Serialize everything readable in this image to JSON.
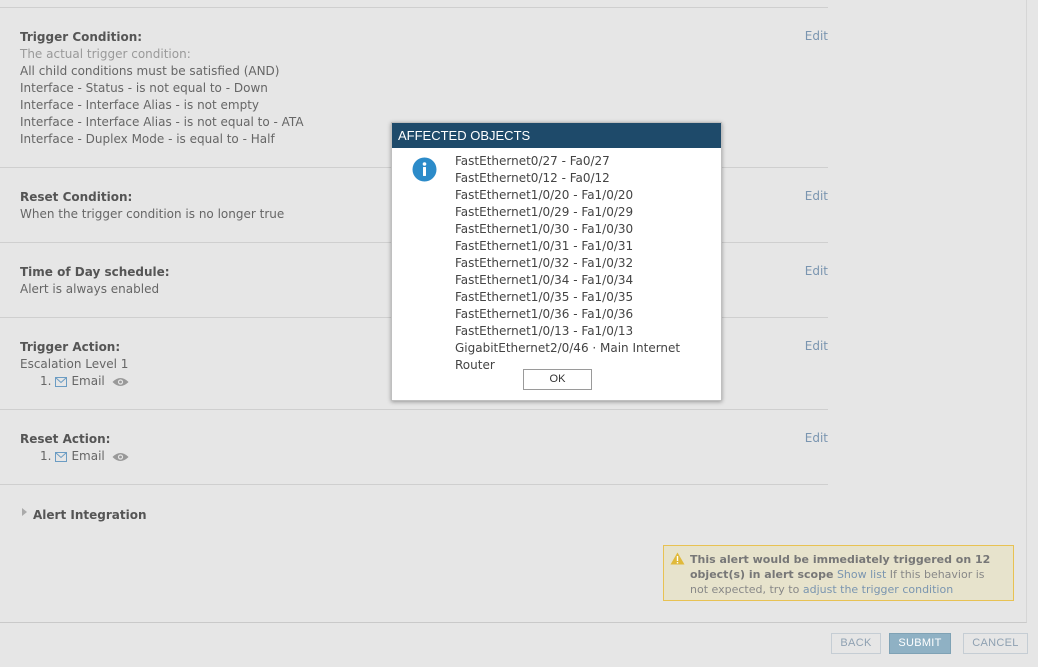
{
  "trigger_condition": {
    "title": "Trigger Condition:",
    "subtitle": "The actual trigger condition:",
    "lines": [
      "All child conditions must be satisfied (AND)",
      "Interface - Status - is not equal to - Down",
      "Interface - Interface Alias - is not empty",
      "Interface - Interface Alias - is not equal to - ATA",
      "Interface - Duplex Mode - is equal to - Half"
    ],
    "edit": "Edit"
  },
  "reset_condition": {
    "title": "Reset Condition:",
    "text": "When the trigger condition is no longer true",
    "edit": "Edit"
  },
  "time_of_day": {
    "title": "Time of Day schedule:",
    "text": "Alert is always enabled",
    "edit": "Edit"
  },
  "trigger_action": {
    "title": "Trigger Action:",
    "level": "Escalation Level 1",
    "item_number": "1.",
    "item_label": "Email",
    "edit": "Edit"
  },
  "reset_action": {
    "title": "Reset Action:",
    "item_number": "1.",
    "item_label": "Email",
    "edit": "Edit"
  },
  "alert_integration": {
    "label": "Alert Integration"
  },
  "warning": {
    "bold_text": "This alert would be immediately triggered on 12 object(s) in alert scope",
    "show_list": "Show list",
    "middle_text": "If this behavior is not expected, try to",
    "adjust_link": "adjust the trigger condition"
  },
  "footer": {
    "back": "BACK",
    "submit": "SUBMIT",
    "cancel": "CANCEL"
  },
  "modal": {
    "title": "AFFECTED OBJECTS",
    "objects": [
      "FastEthernet0/27 - Fa0/27",
      "FastEthernet0/12 - Fa0/12",
      "FastEthernet1/0/20 - Fa1/0/20",
      "FastEthernet1/0/29 - Fa1/0/29",
      "FastEthernet1/0/30 - Fa1/0/30",
      "FastEthernet1/0/31 - Fa1/0/31",
      "FastEthernet1/0/32 - Fa1/0/32",
      "FastEthernet1/0/34 - Fa1/0/34",
      "FastEthernet1/0/35 - Fa1/0/35",
      "FastEthernet1/0/36 - Fa1/0/36",
      "FastEthernet1/0/13 - Fa1/0/13",
      "GigabitEthernet2/0/46 · Main Internet Router"
    ],
    "ok": "OK"
  },
  "colors": {
    "modal_header": "#1e4a6a",
    "link": "#7a95b0",
    "info_icon": "#2c8bc9",
    "warning_border": "#e8c253"
  }
}
